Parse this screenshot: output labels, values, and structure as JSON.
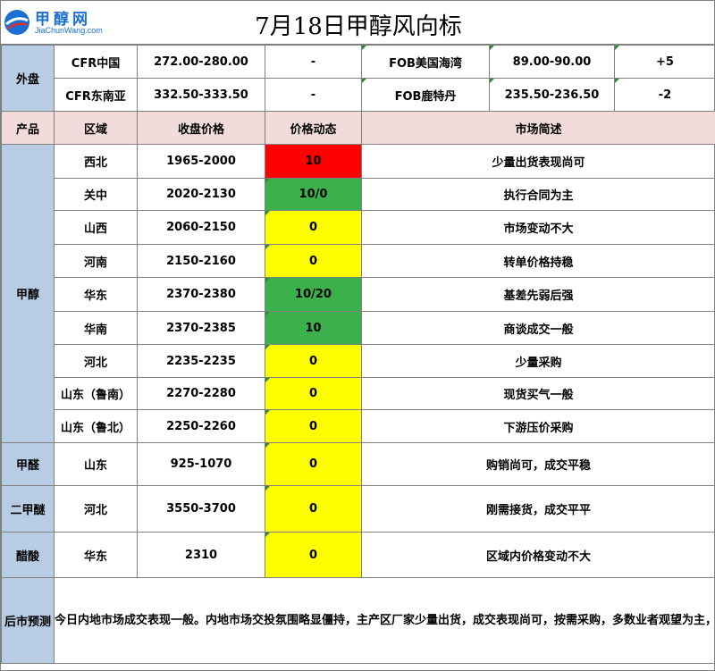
{
  "title": "7月18日甲醇风向标",
  "logo": {
    "cn": "甲醇网",
    "en": "JiaChunWang.com"
  },
  "external": {
    "label": "外盘",
    "rows": [
      {
        "cfr": "CFR中国",
        "cfr_price": "272.00-280.00",
        "cfr_change": "-",
        "fob": "FOB美国海湾",
        "fob_price": "89.00-90.00",
        "fob_change": "+5"
      },
      {
        "cfr": "CFR东南亚",
        "cfr_price": "332.50-333.50",
        "cfr_change": "-",
        "fob": "FOB鹿特丹",
        "fob_price": "235.50-236.50",
        "fob_change": "-2"
      }
    ]
  },
  "headers": {
    "product": "产品",
    "region": "区域",
    "price": "收盘价格",
    "change": "价格动态",
    "summary": "市场简述"
  },
  "products": [
    {
      "name": "甲醇",
      "rows": [
        {
          "region": "西北",
          "price": "1965-2000",
          "change": "10",
          "color": "#ff0000",
          "summary": "少量出货表现尚可"
        },
        {
          "region": "关中",
          "price": "2020-2130",
          "change": "10/0",
          "color": "#3cb04b",
          "summary": "执行合同为主"
        },
        {
          "region": "山西",
          "price": "2060-2150",
          "change": "0",
          "color": "#ffff00",
          "summary": "市场变动不大"
        },
        {
          "region": "河南",
          "price": "2150-2160",
          "change": "0",
          "color": "#ffff00",
          "summary": "转单价格持稳"
        },
        {
          "region": "华东",
          "price": "2370-2380",
          "change": "10/20",
          "color": "#3cb04b",
          "summary": "基差先弱后强"
        },
        {
          "region": "华南",
          "price": "2370-2385",
          "change": "10",
          "color": "#3cb04b",
          "summary": "商谈成交一般"
        },
        {
          "region": "河北",
          "price": "2235-2235",
          "change": "0",
          "color": "#ffff00",
          "summary": "少量采购"
        },
        {
          "region": "山东（鲁南）",
          "price": "2270-2280",
          "change": "0",
          "color": "#ffff00",
          "summary": "现货买气一般"
        },
        {
          "region": "山东（鲁北）",
          "price": "2250-2260",
          "change": "0",
          "color": "#ffff00",
          "summary": "下游压价采购"
        }
      ]
    },
    {
      "name": "甲醛",
      "rows": [
        {
          "region": "山东",
          "price": "925-1070",
          "change": "0",
          "color": "#ffff00",
          "summary": "购销尚可，成交平稳"
        }
      ]
    },
    {
      "name": "二甲醚",
      "rows": [
        {
          "region": "河北",
          "price": "3550-3700",
          "change": "0",
          "color": "#ffff00",
          "summary": "刚需接货，成交平平"
        }
      ]
    },
    {
      "name": "醋酸",
      "rows": [
        {
          "region": "华东",
          "price": "2310",
          "change": "0",
          "color": "#ffff00",
          "summary": "区域内价格变动不大"
        }
      ]
    }
  ],
  "forecast": {
    "label": "后市预测",
    "text": "今日内地市场成交表现一般。内地市场交投氛围略显僵持，主产区厂家少量出货，成交表现尚可，按需采购，多数业者观望为主，贸易商转单价格变动不大，整体幅度相对有限，传统下游需求仍显疲弱，下游跟进一般，多次下调报价，压价采购为主。预计短期甲醇市场走势区间震荡。"
  }
}
